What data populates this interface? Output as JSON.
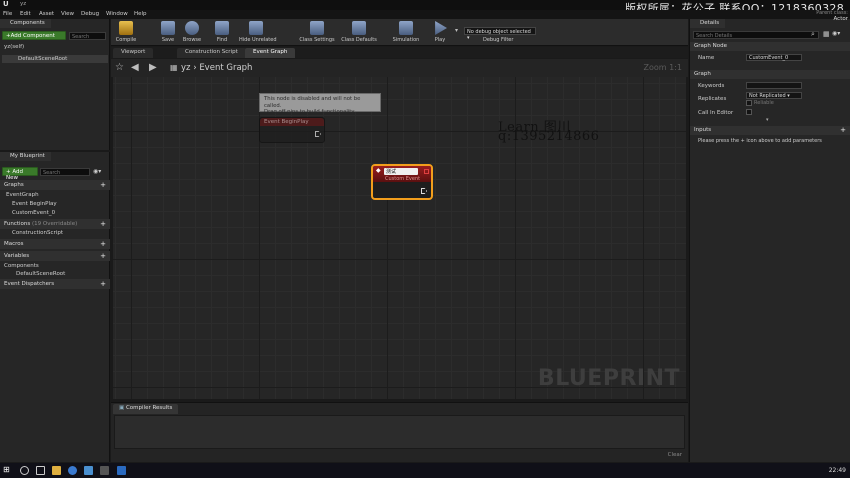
{
  "watermark": "版权所属：花公子 联系QQ：1218360328",
  "menu": [
    "File",
    "Edit",
    "Asset",
    "View",
    "Debug",
    "Window",
    "Help"
  ],
  "components": {
    "tab": "Components",
    "add_button": "+Add Component",
    "search_placeholder": "Search",
    "self_item": "yz(self)",
    "root_item": "DefaultSceneRoot"
  },
  "my_blueprint": {
    "tab": "My Blueprint",
    "add_new": "+ Add New",
    "search_placeholder": "Search",
    "graphs_head": "Graphs",
    "event_graph": "EventGraph",
    "event_beginplay": "Event BeginPlay",
    "custom_event": "CustomEvent_0",
    "functions_head": "Functions",
    "functions_sub": "(19 Overridable)",
    "construction_script": "ConstructionScript",
    "macros_head": "Macros",
    "variables_head": "Variables",
    "components_head": "Components",
    "default_scene_root": "DefaultSceneRoot",
    "dispatchers_head": "Event Dispatchers"
  },
  "toolbar": {
    "compile": "Compile",
    "save": "Save",
    "browse": "Browse",
    "find": "Find",
    "hide_unrelated": "Hide Unrelated",
    "class_settings": "Class Settings",
    "class_defaults": "Class Defaults",
    "simulation": "Simulation",
    "play": "Play",
    "debug_select": "No debug object selected ▾",
    "debug_filter": "Debug Filter"
  },
  "doc_tabs": [
    "Viewport",
    "Construction Script",
    "Event Graph"
  ],
  "graph": {
    "crumb_root": "yz",
    "crumb_sep": "›",
    "crumb_current": "Event Graph",
    "zoom": "Zoom 1:1",
    "disabled_note": "This node is disabled and will not be called.\nDrag off pins to build functionality.",
    "beginplay_title": "Event BeginPlay",
    "custom_name": "测试",
    "custom_sub": "Custom Event",
    "handwrite1": "Learn 图川",
    "handwrite2": "q:1395214866",
    "blueprint_watermark": "BLUEPRINT"
  },
  "compiler": {
    "tab": "Compiler Results",
    "clear": "Clear"
  },
  "details": {
    "tab": "Details",
    "search_placeholder": "Search Details",
    "graph_node_head": "Graph Node",
    "name_label": "Name",
    "name_value": "CustomEvent_0",
    "graph_head": "Graph",
    "keywords_label": "Keywords",
    "replicates_label": "Replicates",
    "replicates_value": "Not Replicated ▾",
    "reliable_label": "Reliable",
    "call_in_editor_label": "Call In Editor",
    "inputs_head": "Inputs",
    "inputs_hint": "Please press the + icon above to add parameters",
    "parent_class": "Parent class:",
    "parent_value": "Actor"
  },
  "taskbar": {
    "clock": "22:49"
  }
}
